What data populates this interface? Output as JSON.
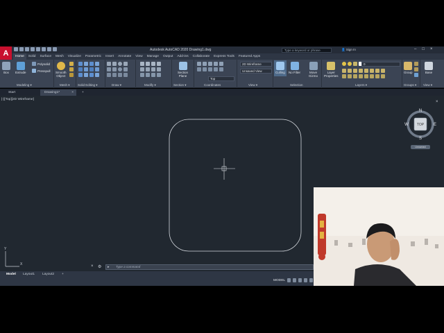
{
  "app": {
    "logo_letter": "A",
    "title": "Autodesk AutoCAD 2020   Drawing1.dwg",
    "search_placeholder": "Type a keyword or phrase",
    "signin": "Sign In",
    "colors": {
      "accent": "#c8102e",
      "canvas": "#212830",
      "ribbon": "#3b4454"
    }
  },
  "ribbon_tabs": [
    "Home",
    "Solid",
    "Surface",
    "Mesh",
    "Visualize",
    "Parametric",
    "Insert",
    "Annotate",
    "View",
    "Manage",
    "Output",
    "Add-ins",
    "Collaborate",
    "Express Tools",
    "Featured Apps"
  ],
  "ribbon": {
    "modeling": {
      "box": "Box",
      "extrude": "Extrude",
      "polysolid": "Polysolid",
      "presspull": "Presspull",
      "smooth_object_1": "Smooth",
      "smooth_object_2": "Object",
      "label": "Modeling ▾"
    },
    "mesh": {
      "label": "Mesh ▾"
    },
    "solid_editing": {
      "label": "Solid Editing ▾"
    },
    "draw": {
      "label": "Draw ▾"
    },
    "modify": {
      "label": "Modify ▾"
    },
    "section": {
      "btn1": "Section",
      "btn2": "Plane",
      "label": "Section ▾"
    },
    "coordinates": {
      "ucs_value": "Top",
      "label": "Coordinates"
    },
    "view_panel": {
      "visual_style": "2D Wireframe",
      "named_view": "Unsaved View",
      "label": "View ▾"
    },
    "selection": {
      "culling": "Culling",
      "no_filter": "No Filter",
      "move_gizmo_1": "Move",
      "move_gizmo_2": "Gizmo",
      "label": "Selection"
    },
    "layers": {
      "layer_props_1": "Layer",
      "layer_props_2": "Properties",
      "current_layer": "0",
      "label": "Layers ▾"
    },
    "groups": {
      "group": "Group",
      "label": "Groups ▾"
    },
    "view_right": {
      "base": "Base",
      "label": "View ▾"
    }
  },
  "file_tabs": {
    "start": "Start",
    "drawing": "Drawing1*",
    "close": "×",
    "add": "+"
  },
  "viewport": {
    "label": "[-][Top][2D Wireframe]",
    "viewcube": {
      "n": "N",
      "s": "S",
      "e": "E",
      "w": "W",
      "face": "TOP",
      "wcs": "Unnamed"
    },
    "ucs_x": "X",
    "ucs_y": "Y"
  },
  "command_line": {
    "placeholder": "Type a command"
  },
  "layout_tabs": [
    "Model",
    "Layout1",
    "Layout2"
  ],
  "layout_add": "+",
  "status": {
    "model": "MODEL"
  }
}
